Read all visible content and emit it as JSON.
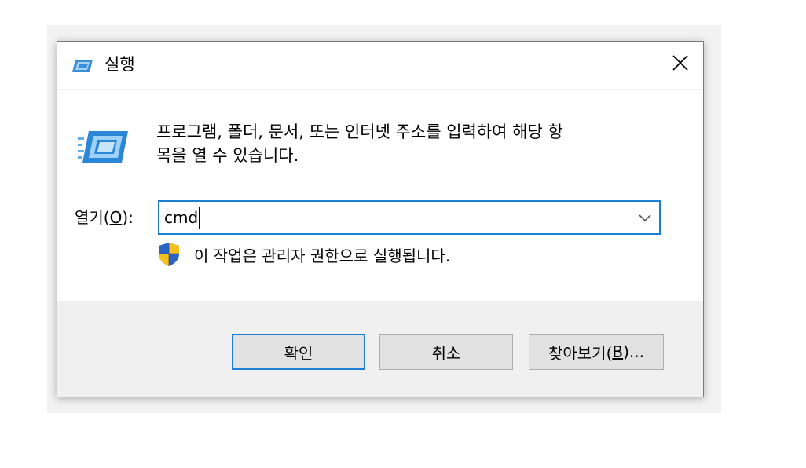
{
  "window": {
    "title": "실행",
    "icon": "run-icon",
    "close_icon": "close-icon"
  },
  "description": {
    "line1": "프로그램, 폴더, 문서, 또는 인터넷 주소를 입력하여 해당 항",
    "line2": "목을 열 수 있습니다."
  },
  "open": {
    "label_prefix": "열기(",
    "label_mnemonic": "O",
    "label_suffix": "):",
    "value": "cmd",
    "dropdown_icon": "chevron-down-icon"
  },
  "admin_notice": {
    "icon": "uac-shield-icon",
    "text": "이 작업은 관리자 권한으로 실행됩니다."
  },
  "buttons": {
    "ok": "확인",
    "cancel": "취소",
    "browse_prefix": "찾아보기(",
    "browse_mnemonic": "B",
    "browse_suffix": ")..."
  },
  "colors": {
    "accent": "#1b7ed4",
    "footer_bg": "#f0f0f0",
    "button_bg": "#e1e1e1"
  }
}
